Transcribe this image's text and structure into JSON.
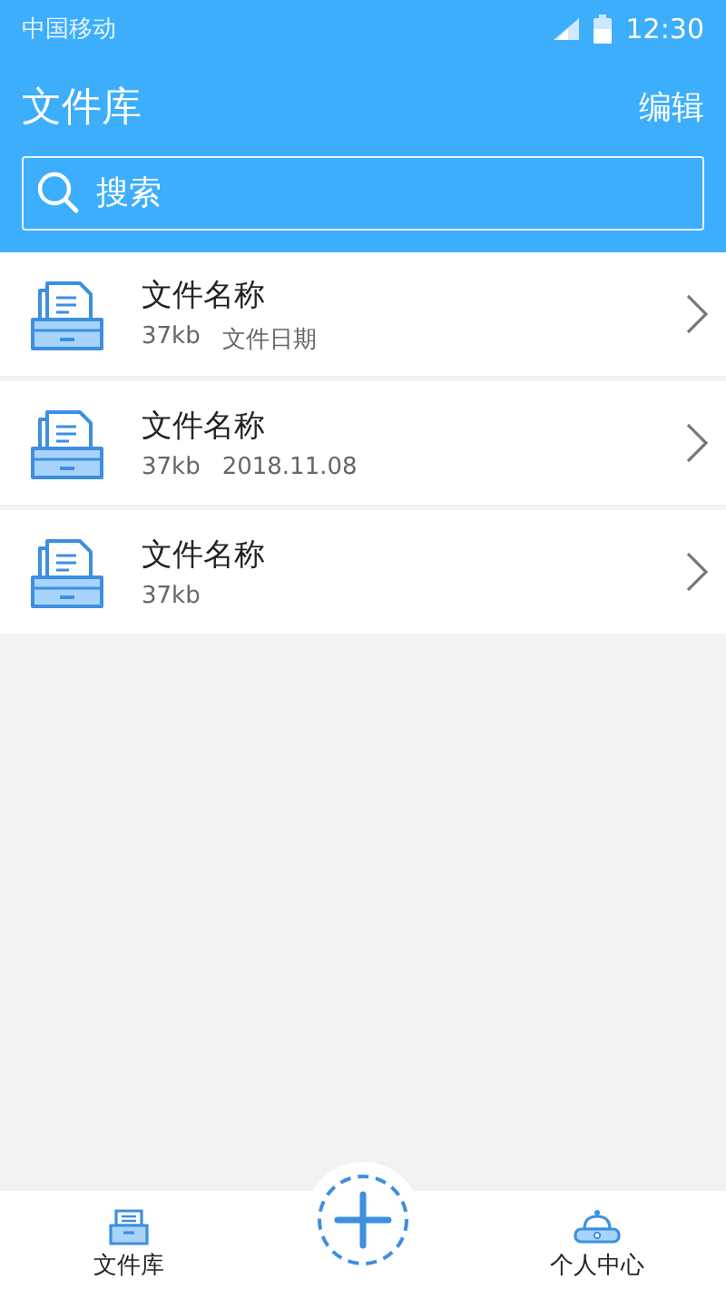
{
  "status_bar": {
    "carrier": "中国移动",
    "time": "12:30"
  },
  "header": {
    "title": "文件库",
    "action": "编辑"
  },
  "search": {
    "placeholder": "搜索"
  },
  "files": [
    {
      "name": "文件名称",
      "size": "37kb",
      "date": "文件日期"
    },
    {
      "name": "文件名称",
      "size": "37kb",
      "date": "2018.11.08"
    },
    {
      "name": "文件名称",
      "size": "37kb"
    }
  ],
  "bottom_nav": [
    {
      "kind": "library",
      "label": "文件库"
    },
    {
      "kind": "add"
    },
    {
      "kind": "profile",
      "label": "个人中心"
    }
  ]
}
